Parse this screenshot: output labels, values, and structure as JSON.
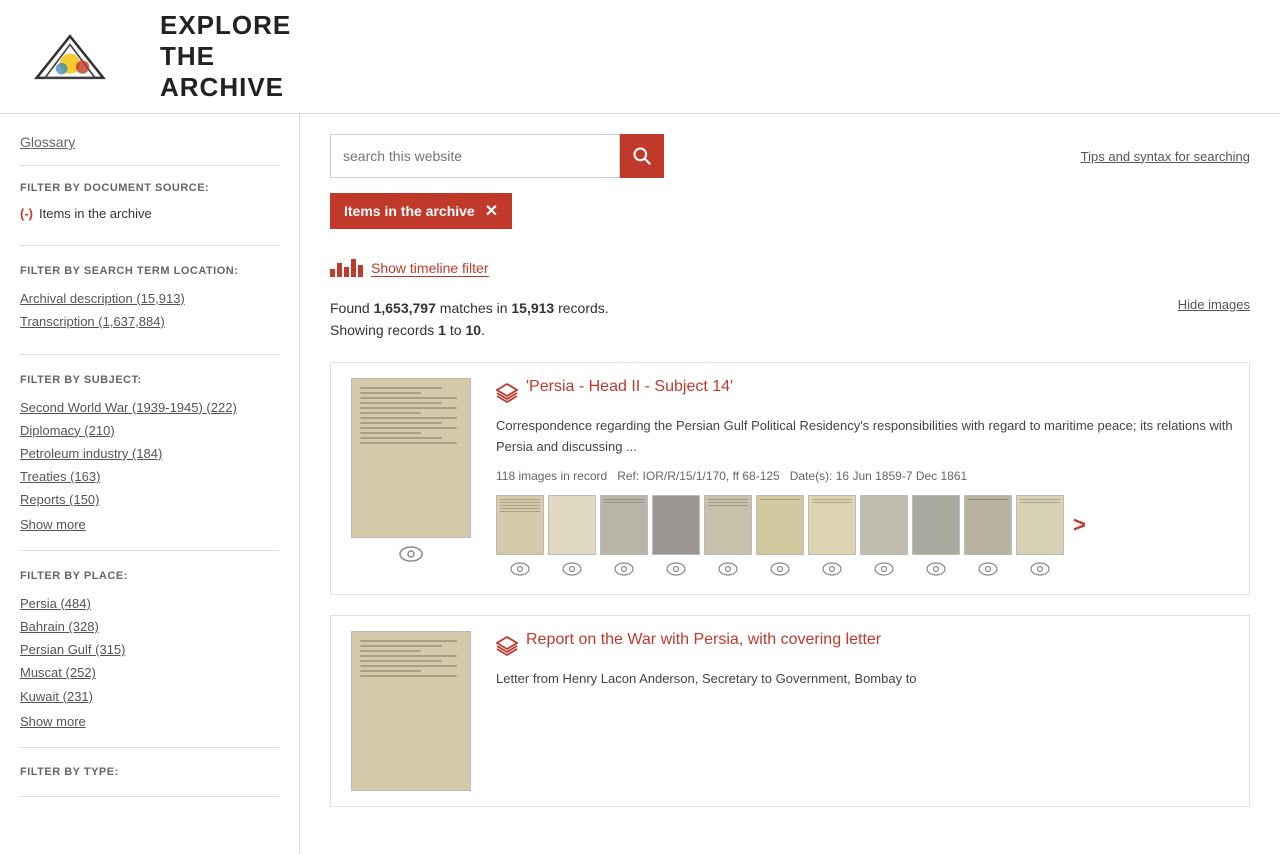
{
  "header": {
    "page_title": "EXPLORE THE ARCHIVE"
  },
  "sidebar": {
    "glossary_label": "Glossary",
    "filter_doc_source": {
      "title": "FILTER BY DOCUMENT SOURCE:",
      "active_filter": "Items in the archive"
    },
    "filter_search_term": {
      "title": "FILTER BY SEARCH TERM LOCATION:",
      "items": [
        "Archival description (15,913)",
        "Transcription (1,637,884)"
      ]
    },
    "filter_subject": {
      "title": "FILTER BY SUBJECT:",
      "items": [
        "Second World War (1939-1945) (222)",
        "Diplomacy (210)",
        "Petroleum industry (184)",
        "Treaties (163)",
        "Reports (150)"
      ],
      "show_more": "Show more"
    },
    "filter_place": {
      "title": "FILTER BY PLACE:",
      "items": [
        "Persia (484)",
        "Bahrain (328)",
        "Persian Gulf (315)",
        "Muscat (252)",
        "Kuwait (231)"
      ],
      "show_more": "Show more"
    },
    "filter_type": {
      "title": "FILTER BY TYPE:"
    }
  },
  "search": {
    "placeholder": "search this website",
    "tips_label": "Tips and syntax for searching"
  },
  "active_filter": {
    "label": "Items in the archive"
  },
  "timeline": {
    "label": "Show timeline filter"
  },
  "results": {
    "matches": "1,653,797",
    "records": "15,913",
    "showing_from": "1",
    "showing_to": "10",
    "hide_images_label": "Hide images",
    "summary_prefix": "Found ",
    "summary_mid": " matches in ",
    "summary_suffix": " records.",
    "showing_text": "Showing records 1 to 10."
  },
  "items": [
    {
      "title": "'Persia - Head II - Subject 14'",
      "icon": "layers",
      "description": "Correspondence regarding the Persian Gulf Political Residency's responsibilities with regard to maritime peace; its relations with Persia and discussing ...",
      "meta_images": "118 images in record",
      "meta_ref": "Ref: IOR/R/15/1/170, ff 68-125",
      "meta_date": "Date(s): 16 Jun 1859-7 Dec 1861",
      "thumb_count": 11
    },
    {
      "title": "Report on the War with Persia, with covering letter",
      "icon": "layers",
      "description": "Letter from Henry Lacon Anderson, Secretary to Government, Bombay to",
      "meta_images": "",
      "meta_ref": "",
      "meta_date": "",
      "thumb_count": 0
    }
  ]
}
